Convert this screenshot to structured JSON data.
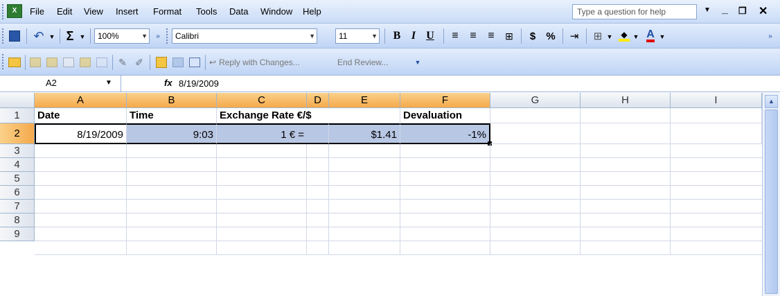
{
  "menu": {
    "items": [
      "File",
      "Edit",
      "View",
      "Insert",
      "Format",
      "Tools",
      "Data",
      "Window",
      "Help"
    ],
    "help_placeholder": "Type a question for help"
  },
  "toolbar": {
    "zoom": "100%",
    "font": "Calibri",
    "font_size": "11",
    "sigma": "Σ",
    "bold": "B",
    "italic": "I",
    "underline": "U",
    "currency": "$",
    "percent": "%"
  },
  "review_toolbar": {
    "reply_label": "Reply with Changes...",
    "end_review_label": "End Review..."
  },
  "formula_bar": {
    "name_box": "A2",
    "fx": "fx",
    "value": "8/19/2009"
  },
  "grid": {
    "columns": [
      "A",
      "B",
      "C",
      "D",
      "E",
      "F",
      "G",
      "H",
      "I"
    ],
    "rows": [
      "1",
      "2",
      "3",
      "4",
      "5",
      "6",
      "7",
      "8",
      "9"
    ],
    "row1": {
      "A": "Date",
      "B": "Time",
      "C": "Exchange Rate €/$",
      "F": "Devaluation"
    },
    "row2": {
      "A": "8/19/2009",
      "B": "9:03",
      "C": "1 € =",
      "E": "$1.41",
      "F": "-1%"
    }
  },
  "colors": {
    "selection": "#b8c7e4",
    "header_selected": "#f5a94c"
  }
}
